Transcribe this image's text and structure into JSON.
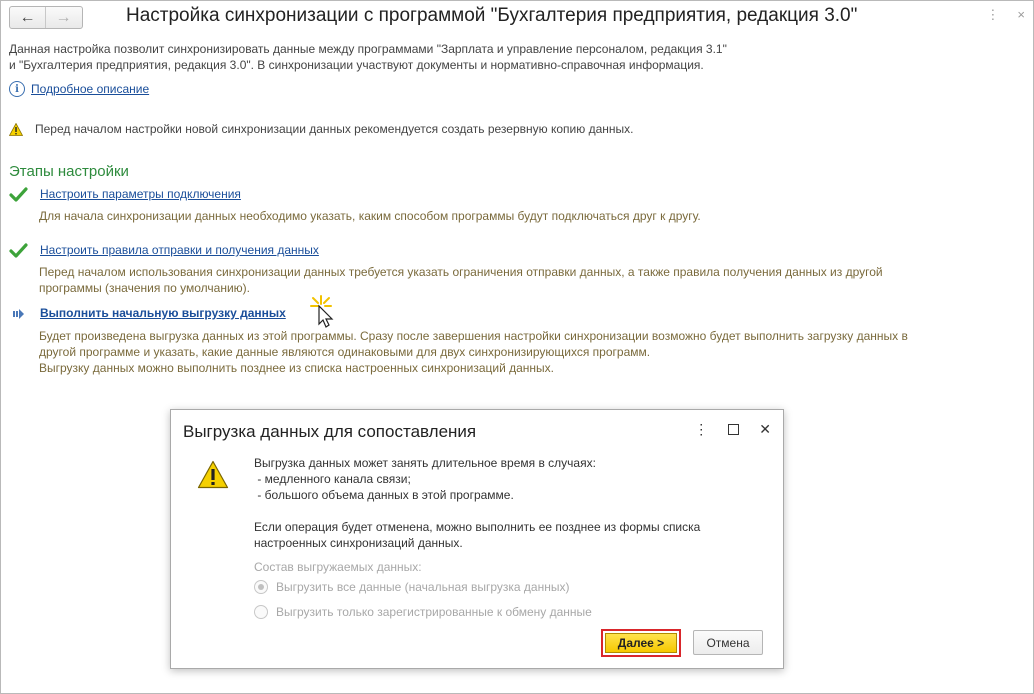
{
  "window": {
    "title": "Настройка синхронизации с программой \"Бухгалтерия предприятия, редакция 3.0\"",
    "nav_back": "←",
    "nav_forward": "→",
    "menu_icon": "⋮",
    "close_icon": "×"
  },
  "intro": {
    "line1": "Данная настройка позволит синхронизировать данные между программами \"Зарплата и управление персоналом, редакция 3.1\"",
    "line2": "и \"Бухгалтерия предприятия, редакция 3.0\". В синхронизации участвуют документы и нормативно-справочная информация.",
    "details_link": "Подробное описание",
    "warning": "Перед началом настройки новой синхронизации данных рекомендуется создать резервную копию данных."
  },
  "stages": {
    "heading": "Этапы настройки",
    "items": [
      {
        "link": "Настроить параметры подключения",
        "status": "done",
        "description": [
          "Для начала синхронизации данных необходимо указать, каким способом программы будут подключаться друг к другу."
        ]
      },
      {
        "link": "Настроить правила отправки и получения данных",
        "status": "done",
        "description": [
          "Перед началом использования синхронизации данных требуется указать ограничения отправки данных, а также правила получения данных из другой",
          "программы (значения по умолчанию)."
        ]
      },
      {
        "link": "Выполнить начальную выгрузку данных",
        "status": "current",
        "description": [
          "Будет произведена выгрузка данных из этой программы. Сразу после завершения настройки синхронизации возможно будет выполнить загрузку данных в",
          "другой программе и указать, какие данные являются одинаковыми для двух синхронизирующихся программ.",
          "Выгрузку данных можно выполнить позднее из списка настроенных синхронизаций данных."
        ]
      }
    ]
  },
  "dialog": {
    "title": "Выгрузка данных для сопоставления",
    "menu_icon": "⋮",
    "close_icon": "✕",
    "text_lines": [
      "Выгрузка данных может занять длительное время в случаях:",
      " - медленного канала связи;",
      " - большого объема данных в этой программе."
    ],
    "text2_lines": [
      "Если операция будет отменена, можно выполнить ее позднее из формы списка",
      "настроенных синхронизаций данных."
    ],
    "group_label": "Состав выгружаемых данных:",
    "options": [
      {
        "label": "Выгрузить все данные (начальная выгрузка данных)",
        "selected": true
      },
      {
        "label": "Выгрузить только зарегистрированные к обмену данные",
        "selected": false
      }
    ],
    "next_button": "Далее >",
    "cancel_button": "Отмена"
  }
}
